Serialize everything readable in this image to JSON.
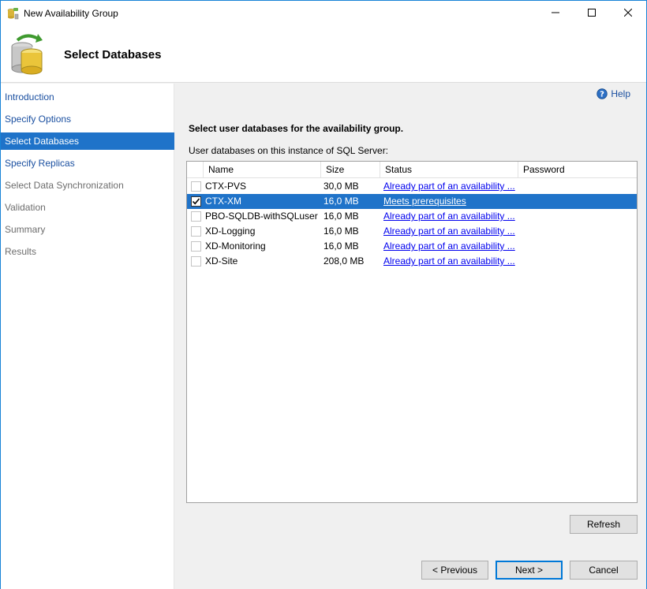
{
  "window": {
    "title": "New Availability Group",
    "minimize_icon": "minimize-icon",
    "maximize_icon": "maximize-icon",
    "close_icon": "close-icon"
  },
  "header": {
    "title": "Select Databases",
    "icon": "availability-group-database-icon"
  },
  "nav": {
    "items": [
      {
        "label": "Introduction",
        "state": "link"
      },
      {
        "label": "Specify Options",
        "state": "link"
      },
      {
        "label": "Select Databases",
        "state": "active"
      },
      {
        "label": "Specify Replicas",
        "state": "link"
      },
      {
        "label": "Select Data Synchronization",
        "state": "disabled"
      },
      {
        "label": "Validation",
        "state": "disabled"
      },
      {
        "label": "Summary",
        "state": "disabled"
      },
      {
        "label": "Results",
        "state": "disabled"
      }
    ]
  },
  "content": {
    "help_label": "Help",
    "instruction": "Select user databases for the availability group.",
    "grid_label": "User databases on this instance of SQL Server:",
    "columns": {
      "name": "Name",
      "size": "Size",
      "status": "Status",
      "password": "Password"
    },
    "rows": [
      {
        "name": "CTX-PVS",
        "size": "30,0 MB",
        "status": "Already part of an availability ...",
        "checked": false,
        "selected": false
      },
      {
        "name": "CTX-XM",
        "size": "16,0 MB",
        "status": "Meets prerequisites",
        "checked": true,
        "selected": true
      },
      {
        "name": "PBO-SQLDB-withSQLuser",
        "size": "16,0 MB",
        "status": "Already part of an availability ...",
        "checked": false,
        "selected": false
      },
      {
        "name": "XD-Logging",
        "size": "16,0 MB",
        "status": "Already part of an availability ...",
        "checked": false,
        "selected": false
      },
      {
        "name": "XD-Monitoring",
        "size": "16,0 MB",
        "status": "Already part of an availability ...",
        "checked": false,
        "selected": false
      },
      {
        "name": "XD-Site",
        "size": "208,0 MB",
        "status": "Already part of an availability ...",
        "checked": false,
        "selected": false
      }
    ],
    "refresh_label": "Refresh"
  },
  "footer": {
    "previous_label": "< Previous",
    "next_label": "Next >",
    "cancel_label": "Cancel"
  },
  "colors": {
    "accent": "#1f73c9",
    "link": "#1a4fa0",
    "hyperlink": "#0000ee",
    "window_border": "#1883d7"
  }
}
